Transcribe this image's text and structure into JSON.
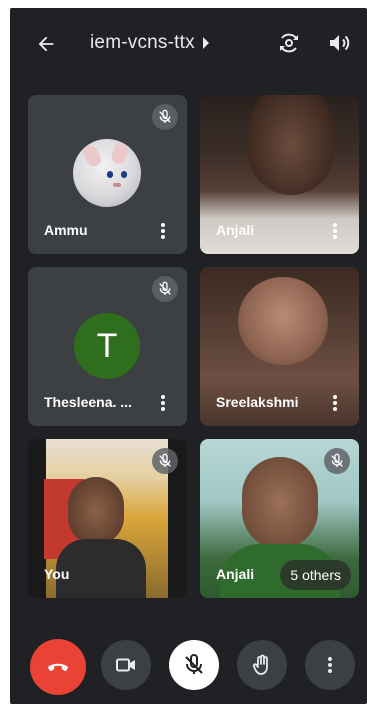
{
  "header": {
    "meeting_code": "iem-vcns-ttx"
  },
  "participants": [
    {
      "name": "Ammu",
      "muted": true,
      "tile": "avatar-image"
    },
    {
      "name": "Anjali",
      "muted": false,
      "tile": "video"
    },
    {
      "name": "Thesleena. ...",
      "muted": true,
      "tile": "initial-avatar",
      "initial": "T"
    },
    {
      "name": "Sreelakshmi",
      "muted": false,
      "tile": "video"
    },
    {
      "name": "You",
      "muted": true,
      "tile": "video"
    },
    {
      "name": "Anjali",
      "muted": true,
      "tile": "video"
    }
  ],
  "others_label": "5 others",
  "controls": [
    "end-call",
    "camera",
    "microphone-muted",
    "raise-hand",
    "more-options"
  ],
  "colors": {
    "background": "#202124",
    "tile": "#3c4043",
    "end_call": "#ea4335",
    "initial_avatar": "#2f6e1c"
  }
}
